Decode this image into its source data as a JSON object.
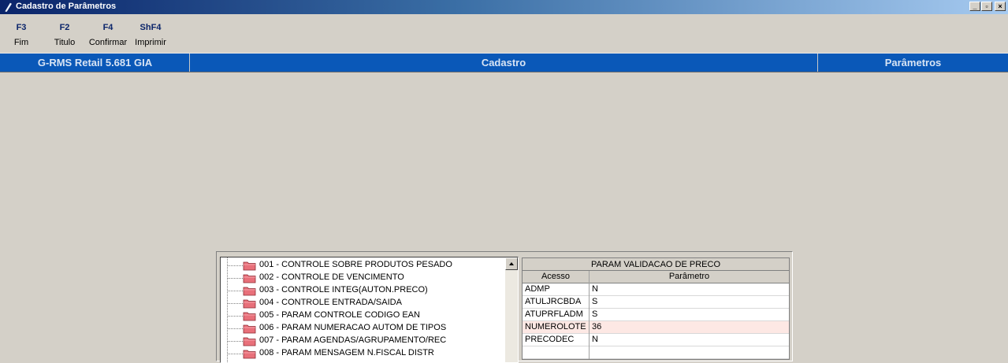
{
  "window": {
    "title": "Cadastro de Parâmetros"
  },
  "toolbar": [
    {
      "key": "F3",
      "label": "Fim"
    },
    {
      "key": "F2",
      "label": "Titulo"
    },
    {
      "key": "F4",
      "label": "Confirmar"
    },
    {
      "key": "ShF4",
      "label": "Imprimir"
    }
  ],
  "header": {
    "app": "G-RMS Retail 5.681 GIA",
    "section": "Cadastro",
    "screen": "Parâmetros"
  },
  "tree": {
    "items": [
      "001 - CONTROLE SOBRE PRODUTOS PESADO",
      "002 - CONTROLE DE VENCIMENTO",
      "003 - CONTROLE INTEG(AUTON.PRECO)",
      "004 - CONTROLE ENTRADA/SAIDA",
      "005 - PARAM CONTROLE CODIGO EAN",
      "006 - PARAM NUMERACAO AUTOM DE TIPOS",
      "007 - PARAM AGENDAS/AGRUPAMENTO/REC",
      "008 - PARAM MENSAGEM N.FISCAL DISTR"
    ]
  },
  "grid": {
    "title": "PARAM VALIDACAO DE PRECO",
    "columns": [
      "Acesso",
      "Parâmetro"
    ],
    "rows": [
      {
        "acesso": "ADMP",
        "parametro": "N"
      },
      {
        "acesso": "ATULJRCBDA",
        "parametro": "S"
      },
      {
        "acesso": "ATUPRFLADM",
        "parametro": "S"
      },
      {
        "acesso": "NUMEROLOTE",
        "parametro": "36"
      },
      {
        "acesso": "PRECODEC",
        "parametro": "N"
      },
      {
        "acesso": "",
        "parametro": ""
      }
    ],
    "highlight_color": "#fde8e4"
  },
  "colors": {
    "titlebar_start": "#0a246a",
    "header_bar": "#0a58b8",
    "window_bg": "#d4d0c8",
    "toolbar_key": "#0a246a",
    "folder": "#e8707a"
  }
}
